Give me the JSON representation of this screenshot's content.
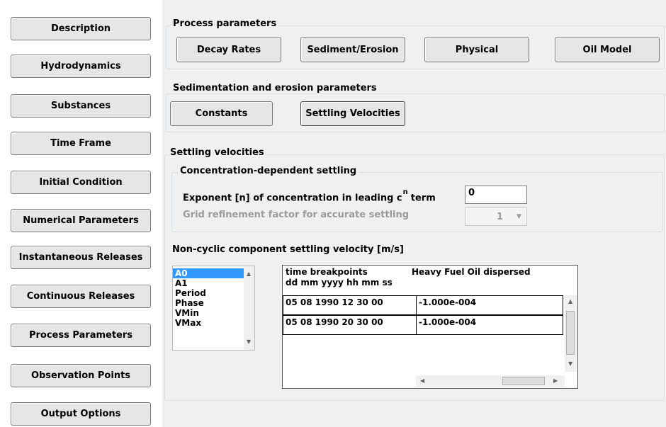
{
  "sidebar": {
    "items": [
      {
        "label": "Description"
      },
      {
        "label": "Hydrodynamics"
      },
      {
        "label": "Substances"
      },
      {
        "label": "Time Frame"
      },
      {
        "label": "Initial Condition"
      },
      {
        "label": "Numerical Parameters"
      },
      {
        "label": "Instantaneous Releases"
      },
      {
        "label": "Continuous Releases"
      },
      {
        "label": "Process Parameters"
      },
      {
        "label": "Observation Points"
      },
      {
        "label": "Output Options"
      }
    ]
  },
  "process_parameters": {
    "title": "Process parameters",
    "tabs": [
      {
        "label": "Decay Rates"
      },
      {
        "label": "Sediment/Erosion"
      },
      {
        "label": "Physical"
      },
      {
        "label": "Oil Model"
      }
    ]
  },
  "sedimentation": {
    "title": "Sedimentation and erosion parameters",
    "tabs": [
      {
        "label": "Constants"
      },
      {
        "label": "Settling Velocities"
      }
    ]
  },
  "settling": {
    "title": "Settling velocities",
    "concentration_group": {
      "title": "Concentration-dependent settling",
      "exponent_label_before": "Exponent [n] of concentration in leading c",
      "exponent_sup": "n",
      "exponent_label_after": "term",
      "exponent_value": "0",
      "grid_label": "Grid refinement factor for accurate settling",
      "grid_value": "1"
    },
    "noncyclic_title": "Non-cyclic component settling velocity [m/s]",
    "components": [
      "A0",
      "A1",
      "Period",
      "Phase",
      "VMin",
      "VMax"
    ],
    "selected_component": "A0",
    "table": {
      "col1_header_line1": "time breakpoints",
      "col1_header_line2": "dd mm yyyy hh mm ss",
      "col2_header": "Heavy Fuel Oil dispersed",
      "rows": [
        {
          "time": "05 08 1990 12 30 00",
          "value": "-1.000e-004"
        },
        {
          "time": "05 08 1990 20 30 00",
          "value": "-1.000e-004"
        }
      ]
    }
  },
  "colors": {
    "selection": "#3399ff",
    "panel_background": "#f0f0f0",
    "button_face": "#e6e6e6"
  }
}
